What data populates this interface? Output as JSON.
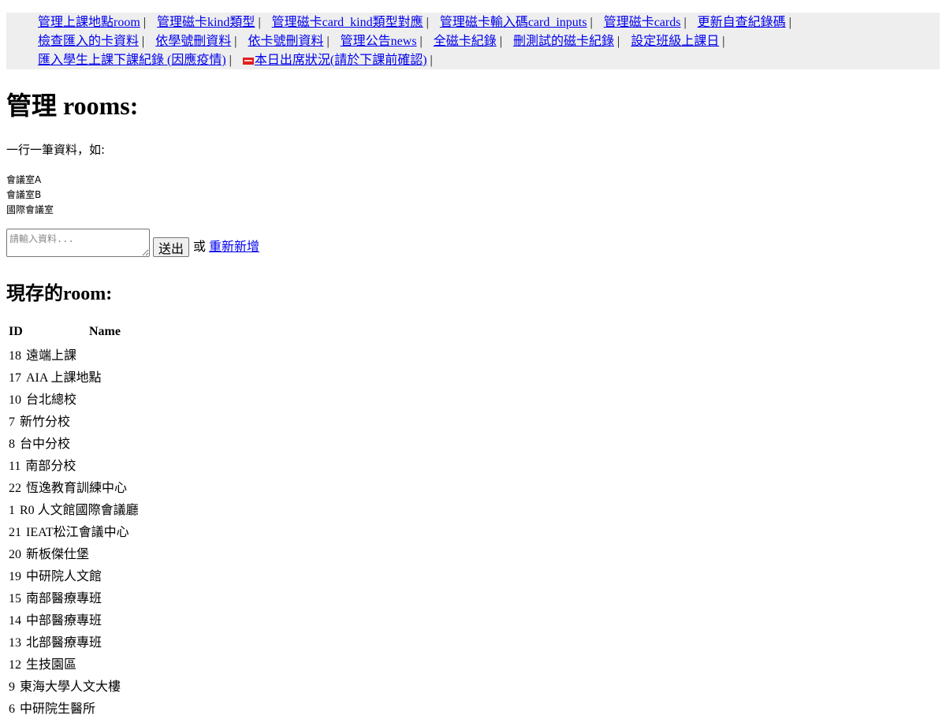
{
  "nav": {
    "links": [
      "管理上課地點room",
      "管理磁卡kind類型",
      "管理磁卡card_kind類型對應",
      "管理磁卡輸入碼card_inputs",
      "管理磁卡cards",
      "更新自查紀錄碼",
      "檢查匯入的卡資料",
      "依學號刪資料",
      "依卡號刪資料",
      "管理公告news",
      "全磁卡紀錄",
      "刪測試的磁卡紀錄",
      "設定班級上課日",
      "匯入學生上課下課紀錄 (因應疫情)",
      "本日出席狀況(請於下課前確認)"
    ],
    "separator": "|"
  },
  "page_title": "管理 rooms:",
  "description": "一行一筆資料，如:",
  "examples": [
    "會議室A",
    "會議室B",
    "國際會議室"
  ],
  "form": {
    "placeholder": "請輸入資料...",
    "submit_label": "送出",
    "or_text": "或",
    "reset_link": "重新新增"
  },
  "list_title": "現存的room:",
  "table": {
    "headers": [
      "ID",
      "Name"
    ],
    "rows": [
      [
        "18",
        "遠端上課"
      ],
      [
        "17",
        "AIA 上課地點"
      ],
      [
        "10",
        "台北總校"
      ],
      [
        "7",
        "新竹分校"
      ],
      [
        "8",
        "台中分校"
      ],
      [
        "11",
        "南部分校"
      ],
      [
        "22",
        "恆逸教育訓練中心"
      ],
      [
        "1",
        "R0 人文館國際會議廳"
      ],
      [
        "21",
        "IEAT松江會議中心"
      ],
      [
        "20",
        "新板傑仕堡"
      ],
      [
        "19",
        "中研院人文館"
      ],
      [
        "15",
        "南部醫療專班"
      ],
      [
        "14",
        "中部醫療專班"
      ],
      [
        "13",
        "北部醫療專班"
      ],
      [
        "12",
        "生技園區"
      ],
      [
        "9",
        "東海大學人文大樓"
      ],
      [
        "6",
        "中研院生醫所"
      ]
    ]
  }
}
